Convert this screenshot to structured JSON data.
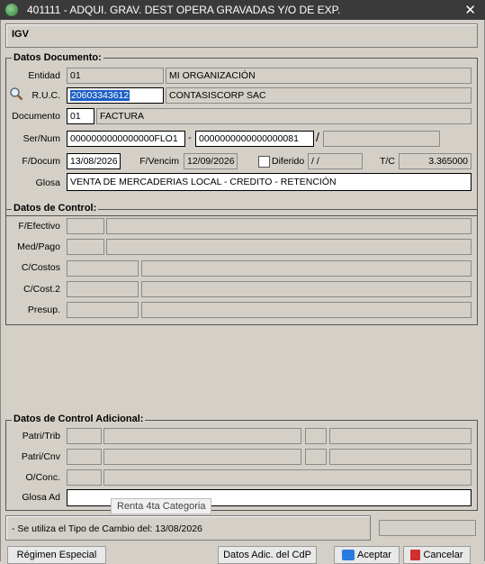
{
  "window": {
    "title": "401111 - ADQUI. GRAV. DEST OPERA GRAVADAS Y/O DE EXP."
  },
  "tax_label": "IGV",
  "doc": {
    "legend": "Datos Documento:",
    "entidad_label": "Entidad",
    "entidad_code": "01",
    "entidad_name": "MI ORGANIZACIÓN",
    "ruc_label": "R.U.C.",
    "ruc_value": "20603343612",
    "ruc_name": "CONTASISCORP SAC",
    "documento_label": "Documento",
    "documento_code": "01",
    "documento_name": "FACTURA",
    "sernum_label": "Ser/Num",
    "serie": "0000000000000000FLO1",
    "dash": "-",
    "numero": "0000000000000000081",
    "slash": "/",
    "fdocum_label": "F/Docum",
    "fdocum": "13/08/2026",
    "fvencim_label": "F/Vencim",
    "fvencim": "12/09/2026",
    "diferido_label": "Diferido",
    "diferido_value": " /  /",
    "tc_label": "T/C",
    "tc": "3.365000",
    "glosa_label": "Glosa",
    "glosa": "VENTA DE MERCADERIAS LOCAL - CREDITO - RETENCIÓN"
  },
  "control": {
    "legend": "Datos de Control:",
    "fefectivo_label": "F/Efectivo",
    "medpago_label": "Med/Pago",
    "ccostos_label": "C/Costos",
    "ccost2_label": "C/Cost.2",
    "presup_label": "Presup."
  },
  "control_adicional": {
    "legend": "Datos de Control Adicional:",
    "patritrib_label": "Patri/Trib",
    "patricnv_label": "Patri/Cnv",
    "oconc_label": "O/Conc.",
    "glosaad_label": "Glosa Ad"
  },
  "tooltip": "Renta 4ta Categoria",
  "status_text": "- Se utiliza el Tipo de Cambio del: 13/08/2026",
  "buttons": {
    "regimen": "Régimen Especial",
    "datos_adic": "Datos Adic. del CdP",
    "aceptar": "Aceptar",
    "cancelar": "Cancelar"
  }
}
